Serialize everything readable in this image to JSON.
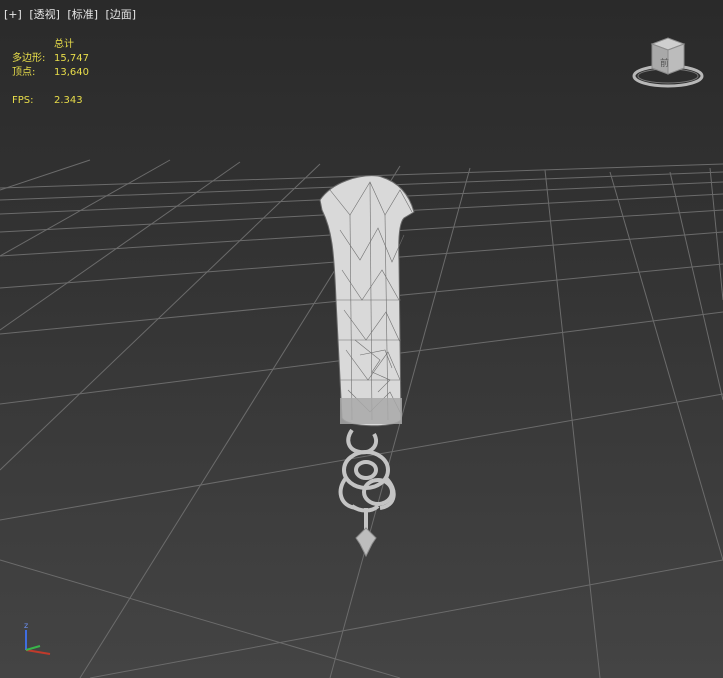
{
  "viewport": {
    "labels": [
      "[+]",
      "[透视]",
      "[标准]",
      "[边面]"
    ]
  },
  "stats": {
    "header": "总计",
    "polygons_label": "多边形:",
    "polygons_value": "15,747",
    "vertices_label": "顶点:",
    "vertices_value": "13,640",
    "fps_label": "FPS:",
    "fps_value": "2.343"
  },
  "viewcube": {
    "face_label": "前"
  },
  "axis": {
    "z_label": "z"
  },
  "colors": {
    "stats_text": "#e8dd4a",
    "grid": "#6b6b6b",
    "model_fill": "#d9d9d9",
    "model_wire": "#5a5a5a",
    "axis_x": "#c03a2b",
    "axis_y": "#39b44a",
    "axis_z": "#3f6de0"
  }
}
